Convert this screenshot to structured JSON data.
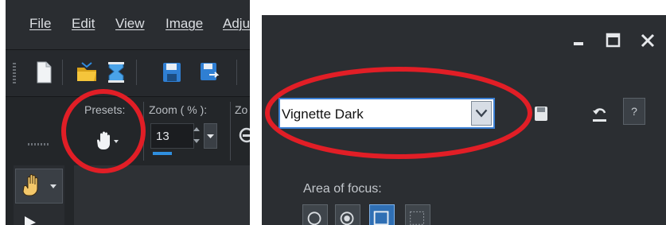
{
  "left_window": {
    "menu": [
      "File",
      "Edit",
      "View",
      "Image",
      "Adju"
    ],
    "toolbar_icons": [
      "new-file-icon",
      "open-folder-icon",
      "browse-icon",
      "save-icon",
      "save-as-icon"
    ],
    "presets_label": "Presets:",
    "zoom_label": "Zoom ( % ):",
    "zoom_value": "13",
    "truncated_label": "Zo",
    "active_tool": "pan-tool-icon"
  },
  "right_window": {
    "window_controls": [
      "minimize-icon",
      "maximize-icon",
      "close-icon"
    ],
    "preset_value": "Vignette Dark",
    "help_label": "?",
    "area_of_focus_label": "Area of focus:"
  },
  "annotation_color": "#e11e26",
  "accent_color": "#3b7fd4"
}
